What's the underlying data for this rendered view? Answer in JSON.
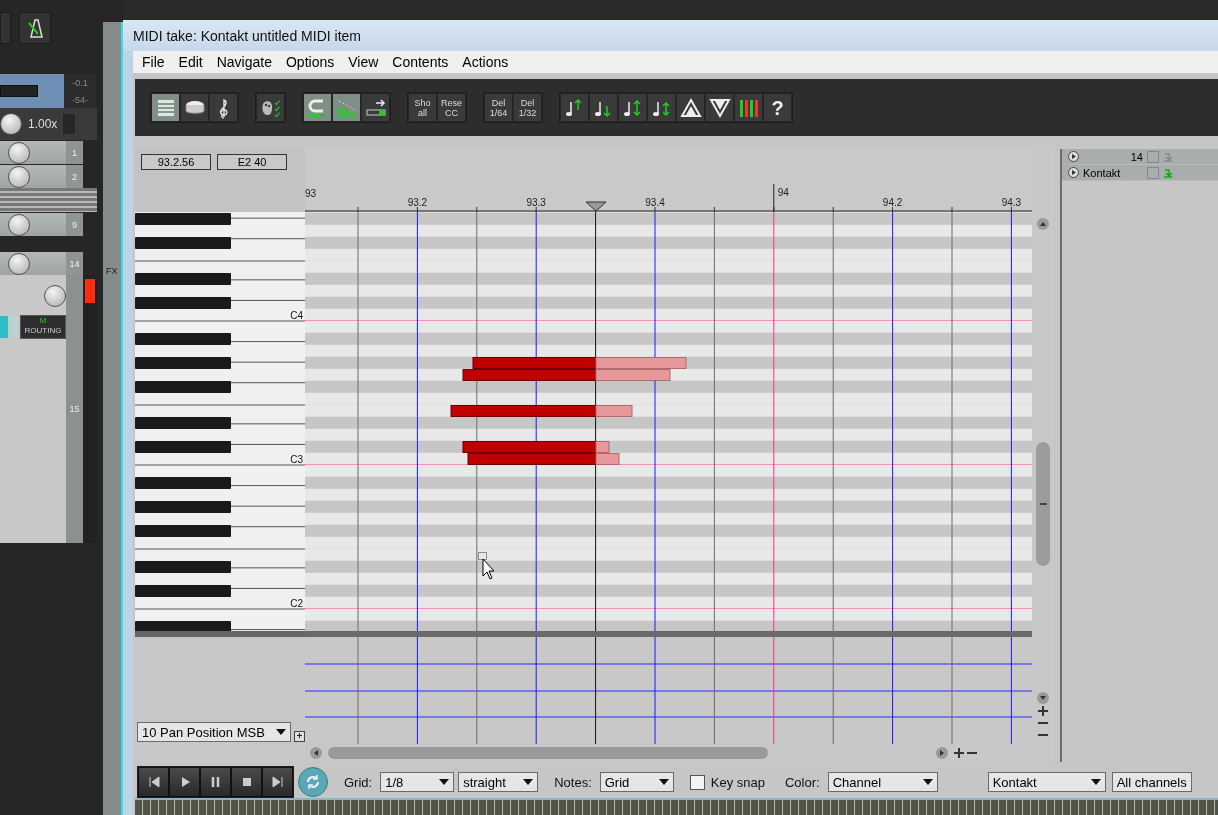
{
  "mixer": {
    "readouts": [
      "-0.1",
      "-54-"
    ],
    "rate": "1.00x",
    "tracks": [
      {
        "number": "1"
      },
      {
        "number": "2"
      },
      {
        "number": "9"
      },
      {
        "number": "14"
      }
    ],
    "fx_label": "FX",
    "mute_label": "M",
    "routing_label": "ROUTING",
    "fader_number": "15"
  },
  "window": {
    "title": "MIDI take: Kontakt untitled MIDI item"
  },
  "menu": [
    "File",
    "Edit",
    "Navigate",
    "Options",
    "View",
    "Contents",
    "Actions"
  ],
  "toolbar": [
    [
      {
        "kind": "icon",
        "selected": true
      },
      {
        "kind": "icon",
        "selected": false
      },
      {
        "kind": "icon",
        "selected": false
      }
    ],
    [
      {
        "kind": "icon",
        "selected": false
      }
    ],
    [
      {
        "kind": "icon",
        "selected": true
      },
      {
        "kind": "icon",
        "selected": true
      },
      {
        "kind": "icon",
        "selected": false
      }
    ],
    [
      {
        "kind": "text",
        "label": "Sho all",
        "selected": false
      },
      {
        "kind": "text",
        "label": "Rese CC",
        "selected": false
      }
    ],
    [
      {
        "kind": "text",
        "label": "Del 1/64",
        "selected": false
      },
      {
        "kind": "text",
        "label": "Del 1/32",
        "selected": false
      }
    ],
    [
      {
        "kind": "icon",
        "selected": false
      },
      {
        "kind": "icon",
        "selected": false
      },
      {
        "kind": "icon",
        "selected": false
      },
      {
        "kind": "icon",
        "selected": false
      },
      {
        "kind": "icon",
        "selected": false
      },
      {
        "kind": "icon",
        "selected": false
      },
      {
        "kind": "icon",
        "selected": false
      },
      {
        "kind": "text",
        "label": "?",
        "selected": false
      }
    ]
  ],
  "position_fields": [
    "93.2.56",
    "E2  40"
  ],
  "ruler": [
    {
      "kind": "bar",
      "label": "93"
    },
    {
      "kind": "beat",
      "label": "93.2"
    },
    {
      "kind": "beat",
      "label": "93.3"
    },
    {
      "kind": "beat",
      "label": "93.4"
    },
    {
      "kind": "bar",
      "label": "94"
    },
    {
      "kind": "beat",
      "label": "94.2"
    },
    {
      "kind": "beat",
      "label": "94.3"
    }
  ],
  "keyboard_labels": [
    "C4",
    "C3",
    "C2"
  ],
  "cc_lane": {
    "selection": "10 Pan Position MSB"
  },
  "track_list": [
    {
      "name": "14",
      "kind": "number",
      "checked": false
    },
    {
      "name": "Kontakt",
      "kind": "name",
      "checked": false
    }
  ],
  "bottom_bar": {
    "grid_label": "Grid:",
    "grid": "1/8",
    "grid_type": "straight",
    "notes_label": "Notes:",
    "notes": "Grid",
    "key_snap": {
      "label": "Key snap",
      "checked": false
    },
    "color_label": "Color:",
    "color_mode": "Channel",
    "instrument": "Kontakt",
    "channels": "All channels"
  }
}
